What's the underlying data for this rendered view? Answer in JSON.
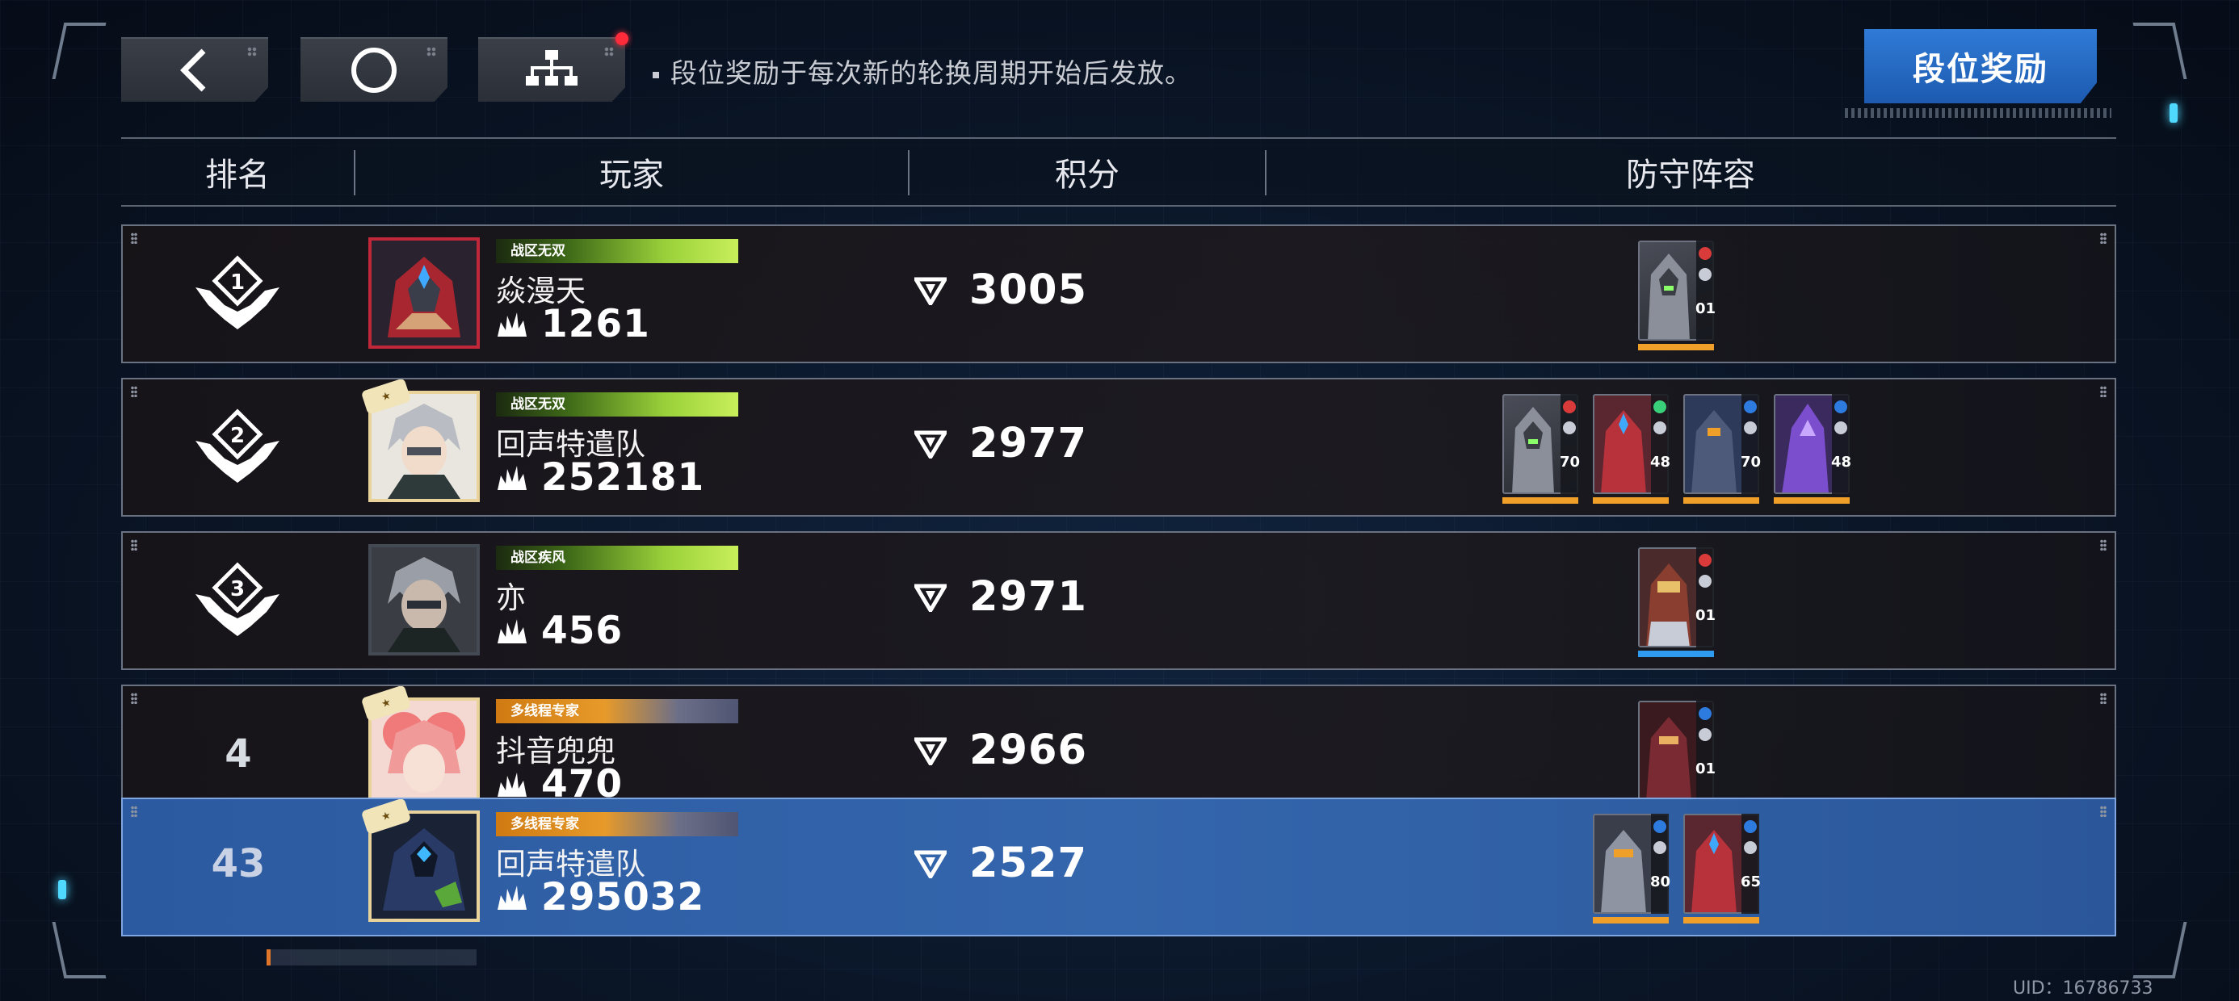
{
  "toolbar": {
    "back_icon": "back-chevron-icon",
    "circle_icon": "circle-icon",
    "hierarchy_icon": "hierarchy-icon",
    "notice": "段位奖励于每次新的轮换周期开始后发放。",
    "reward_button": "段位奖励"
  },
  "table": {
    "headers": [
      "排名",
      "玩家",
      "积分",
      "防守阵容"
    ],
    "rows": [
      {
        "rank": "1",
        "rank_style": "badge",
        "title": "战区无双",
        "title_color": "green",
        "name": "焱漫天",
        "power": "1261",
        "score": "3005",
        "avatar_frame": "red",
        "units": [
          {
            "level": "01",
            "bar": "orange"
          }
        ]
      },
      {
        "rank": "2",
        "rank_style": "badge",
        "title": "战区无双",
        "title_color": "green",
        "name": "回声特遣队",
        "power": "252181",
        "score": "2977",
        "avatar_frame": "gold",
        "units": [
          {
            "level": "70",
            "bar": "orange"
          },
          {
            "level": "48",
            "bar": "orange"
          },
          {
            "level": "70",
            "bar": "orange"
          },
          {
            "level": "48",
            "bar": "orange"
          }
        ]
      },
      {
        "rank": "3",
        "rank_style": "badge",
        "title": "战区疾风",
        "title_color": "green",
        "name": "亦",
        "power": "456",
        "score": "2971",
        "avatar_frame": "gray",
        "units": [
          {
            "level": "01",
            "bar": "blue"
          }
        ]
      },
      {
        "rank": "4",
        "rank_style": "number",
        "title": "多线程专家",
        "title_color": "orange",
        "name": "抖音兜兜",
        "power": "470",
        "score": "2966",
        "avatar_frame": "gold",
        "units": [
          {
            "level": "01",
            "bar": "orange"
          }
        ]
      }
    ],
    "self_row": {
      "rank": "43",
      "title": "多线程专家",
      "name": "回声特遣队",
      "power": "295032",
      "score": "2527",
      "units": [
        {
          "level": "80",
          "bar": "orange"
        },
        {
          "level": "65",
          "bar": "orange"
        }
      ]
    }
  },
  "footer": {
    "uid": "UID：16786733"
  },
  "colors": {
    "accent_blue": "#2f7bd6",
    "self_row_blue": "#3466ad",
    "notify_red": "#ff2a3a",
    "unit_orange": "#f0a028",
    "unit_blue": "#2e9bf0"
  }
}
